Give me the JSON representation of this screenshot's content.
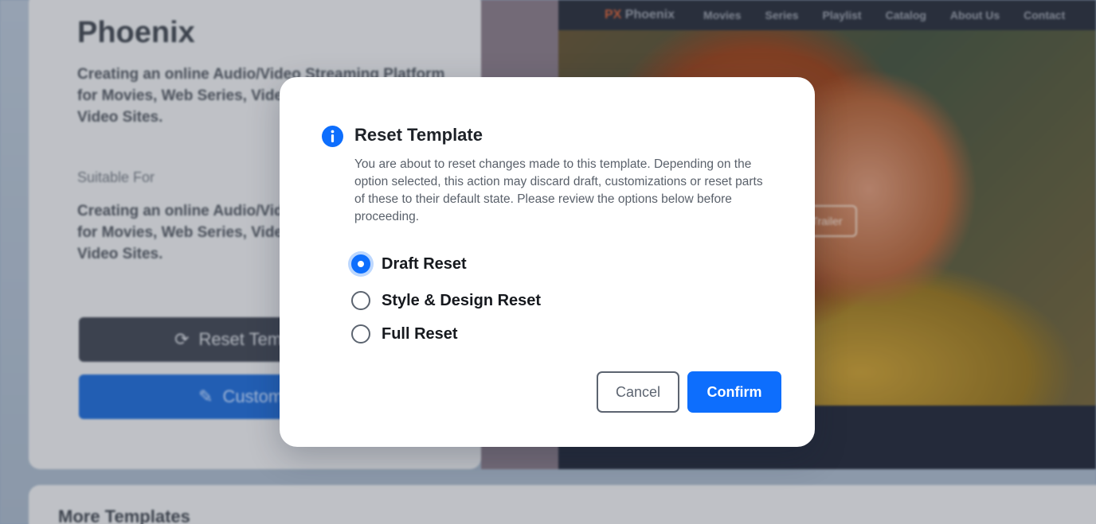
{
  "background": {
    "title": "Phoenix",
    "description": "Creating an online Audio/Video Streaming Platform for Movies, Web Series, Video Streaming Websites, Video Sites.",
    "suitable_label": "Suitable For",
    "suitable_text": "Creating an online Audio/Video Streaming Platform for Movies, Web Series, Video Streaming Websites, Video Sites.",
    "reset_button_label": "Reset Template",
    "customize_button_label": "Customize",
    "more_templates_title": "More Templates",
    "preview": {
      "logo_prefix": "PX",
      "logo_text": "Phoenix",
      "nav_items": [
        "Movies",
        "Series",
        "Playlist",
        "Catalog",
        "About Us",
        "Contact"
      ],
      "hero_button": "Trailer"
    }
  },
  "modal": {
    "title": "Reset Template",
    "icon": "info-icon",
    "description": "You are about to reset changes made to this template. Depending on the option selected, this action may discard draft, customizations or reset parts of these to their default state. Please review the options below before proceeding.",
    "options": [
      {
        "label": "Draft Reset",
        "checked": true
      },
      {
        "label": "Style & Design Reset",
        "checked": false
      },
      {
        "label": "Full Reset",
        "checked": false
      }
    ],
    "cancel_label": "Cancel",
    "confirm_label": "Confirm"
  },
  "colors": {
    "accent": "#0d6efd",
    "title_text": "#1e2228",
    "body_text": "#5a616b"
  }
}
